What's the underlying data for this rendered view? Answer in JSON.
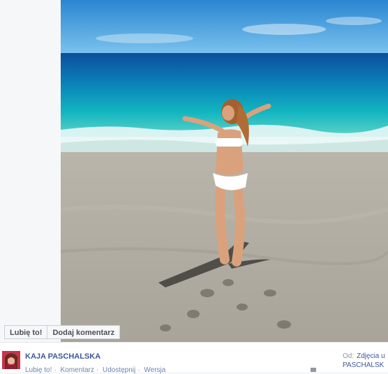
{
  "buttons": {
    "like_label": "Lubię to!",
    "comment_label": "Dodaj komentarz"
  },
  "post": {
    "author_name": "KAJA PASCHALSKA",
    "actions": [
      "Lubię to!",
      "Komentarz",
      "Udostępnij",
      "Wersja"
    ],
    "from_label": "Od:",
    "album_text": "Zdjęcia u",
    "album_owner": "PASCHALSK"
  },
  "photo": {
    "subject": "woman in white bikini on beach with arms outstretched"
  },
  "colors": {
    "link": "#3b5998",
    "button_bg": "#f6f7f9",
    "sea": "#0fa7b8",
    "sky": "#2f8fd6"
  }
}
